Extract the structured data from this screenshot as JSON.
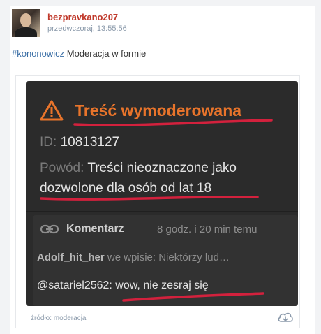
{
  "post": {
    "author": "bezpravkano207",
    "timestamp": "przedwczoraj, 13:55:56",
    "hashtag": "#kononowicz",
    "text": " Moderacja w formie"
  },
  "screenshot": {
    "title": "Treść wymoderowana",
    "id_label": "ID:",
    "id_value": "10813127",
    "reason_label": "Powód:",
    "reason_line1": "Treści nieoznaczone jako",
    "reason_line2": "dozwolone dla osób od lat 18",
    "comment_label": "Komentarz",
    "comment_time": "8 godz. i 20 min temu",
    "comment_author": "Adolf_hit_her",
    "comment_context": " we wpisie: Niektórzy lud…",
    "comment_body": "@satariel2562: wow, nie zesraj się"
  },
  "embed": {
    "source": "źródło: moderacja"
  },
  "colors": {
    "username": "#c0392b",
    "hashtag": "#3a6ea5",
    "warning": "#e8742b",
    "underline": "#d3213d"
  }
}
